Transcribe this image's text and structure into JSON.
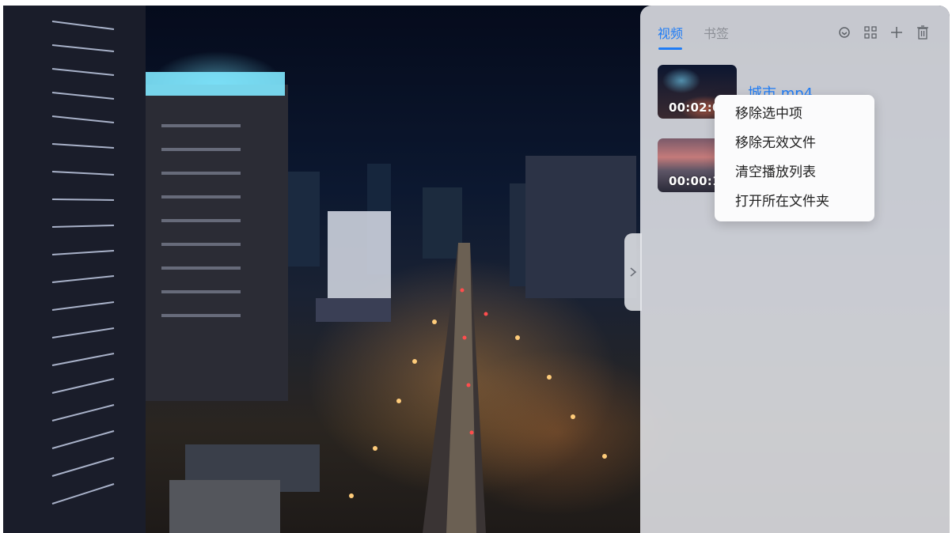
{
  "tabs": [
    {
      "label": "视频",
      "active": true
    },
    {
      "label": "书签",
      "active": false
    }
  ],
  "toolbar": {
    "icons": [
      "playlist-cycle-icon",
      "grid-view-icon",
      "add-icon",
      "delete-icon"
    ]
  },
  "playlist": [
    {
      "duration": "00:02:0",
      "name": "城市.mp4"
    },
    {
      "duration": "00:00:1",
      "name": ""
    }
  ],
  "context_menu": {
    "items": [
      "移除选中项",
      "移除无效文件",
      "清空播放列表",
      "打开所在文件夹"
    ]
  },
  "colors": {
    "accent": "#1f7cf5"
  }
}
